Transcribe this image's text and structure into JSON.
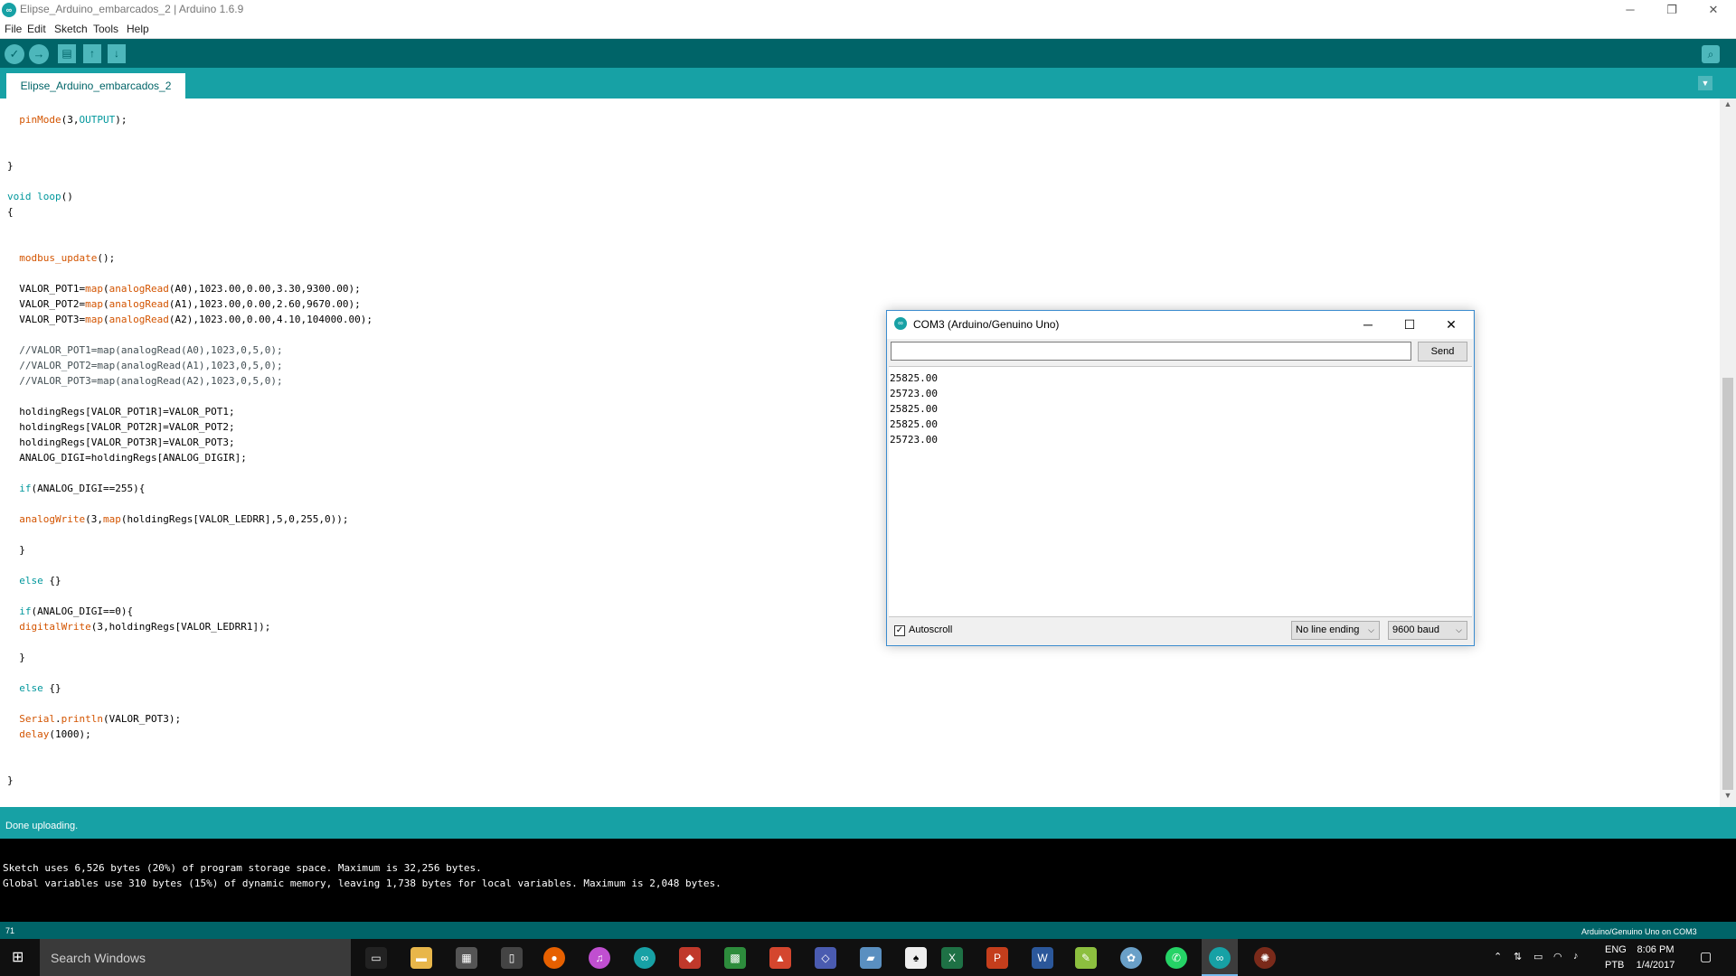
{
  "window": {
    "title": "Elipse_Arduino_embarcados_2 | Arduino 1.6.9",
    "minimize": "─",
    "restore": "❐",
    "close": "✕"
  },
  "menu": [
    "File",
    "Edit",
    "Sketch",
    "Tools",
    "Help"
  ],
  "tab": {
    "label": "Elipse_Arduino_embarcados_2"
  },
  "editor": {
    "lines": [
      "  pinMode(3,OUTPUT);",
      "",
      "",
      "}",
      "",
      "void loop()",
      "{",
      "",
      "",
      "  modbus_update();",
      "",
      "  VALOR_POT1=map(analogRead(A0),1023.00,0.00,3.30,9300.00);",
      "  VALOR_POT2=map(analogRead(A1),1023.00,0.00,2.60,9670.00);",
      "  VALOR_POT3=map(analogRead(A2),1023.00,0.00,4.10,104000.00);",
      "",
      "  //VALOR_POT1=map(analogRead(A0),1023,0,5,0);",
      "  //VALOR_POT2=map(analogRead(A1),1023,0,5,0);",
      "  //VALOR_POT3=map(analogRead(A2),1023,0,5,0);",
      "",
      "  holdingRegs[VALOR_POT1R]=VALOR_POT1;",
      "  holdingRegs[VALOR_POT2R]=VALOR_POT2;",
      "  holdingRegs[VALOR_POT3R]=VALOR_POT3;",
      "  ANALOG_DIGI=holdingRegs[ANALOG_DIGIR];",
      "",
      "  if(ANALOG_DIGI==255){",
      "",
      "  analogWrite(3,map(holdingRegs[VALOR_LEDRR],5,0,255,0));",
      "",
      "  }",
      "",
      "  else {}",
      "",
      "  if(ANALOG_DIGI==0){",
      "  digitalWrite(3,holdingRegs[VALOR_LEDRR1]);",
      "",
      "  }",
      "",
      "  else {}",
      "",
      "  Serial.println(VALOR_POT3);",
      "  delay(1000);",
      "",
      "",
      "}"
    ]
  },
  "status": {
    "message": "Done uploading."
  },
  "console": {
    "lines": [
      "Sketch uses 6,526 bytes (20%) of program storage space. Maximum is 32,256 bytes.",
      "Global variables use 310 bytes (15%) of dynamic memory, leaving 1,738 bytes for local variables. Maximum is 2,048 bytes."
    ]
  },
  "footer": {
    "line_number": "71",
    "board": "Arduino/Genuino Uno on COM3"
  },
  "serial_monitor": {
    "title": "COM3 (Arduino/Genuino Uno)",
    "input_value": "",
    "send_label": "Send",
    "output": [
      "25825.00",
      "25723.00",
      "25825.00",
      "25825.00",
      "25723.00"
    ],
    "autoscroll_label": "Autoscroll",
    "autoscroll_checked": true,
    "line_ending": "No line ending",
    "baud": "9600 baud"
  },
  "taskbar": {
    "search_placeholder": "Search Windows",
    "time": "8:06 PM",
    "date": "1/4/2017",
    "lang_top": "ENG",
    "lang_bottom": "PTB"
  },
  "colors": {
    "toolbar": "#006468",
    "tabbar": "#17a1a5",
    "accent": "#4db7bb"
  }
}
